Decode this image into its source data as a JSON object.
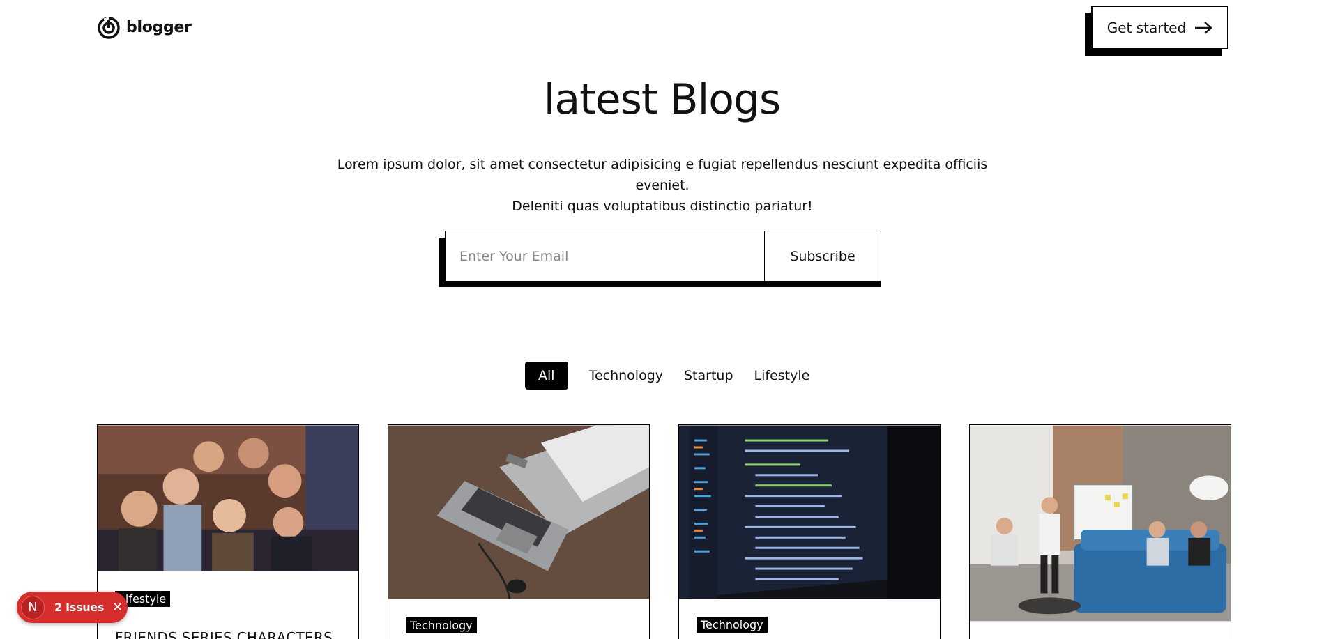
{
  "header": {
    "logo_text": "blogger",
    "cta_label": "Get started"
  },
  "hero": {
    "title": "latest Blogs",
    "subtitle_line1": "Lorem ipsum dolor, sit amet consectetur adipisicing e fugiat repellendus nesciunt expedita officiis eveniet.",
    "subtitle_line2": "Deleniti quas voluptatibus distinctio pariatur!"
  },
  "subscribe": {
    "placeholder": "Enter Your Email",
    "value": "",
    "button_label": "Subscribe"
  },
  "filters": [
    {
      "label": "All",
      "active": true
    },
    {
      "label": "Technology",
      "active": false
    },
    {
      "label": "Startup",
      "active": false
    },
    {
      "label": "Lifestyle",
      "active": false
    }
  ],
  "cards": [
    {
      "tag": "Lifestyle",
      "title": "FRIENDS SERIES CHARACTERS",
      "image": "group-of-friends-photo"
    },
    {
      "tag": "Technology",
      "title": "",
      "image": "laptop-on-desk-photo"
    },
    {
      "tag": "Technology",
      "title": "",
      "image": "code-on-screen-photo"
    },
    {
      "tag": "",
      "title": "",
      "image": "office-team-meeting-photo"
    }
  ],
  "issues_badge": {
    "letter": "N",
    "label": "2 Issues",
    "color": "#d62d2d"
  },
  "colors": {
    "accent": "#000000",
    "background": "#ffffff"
  }
}
